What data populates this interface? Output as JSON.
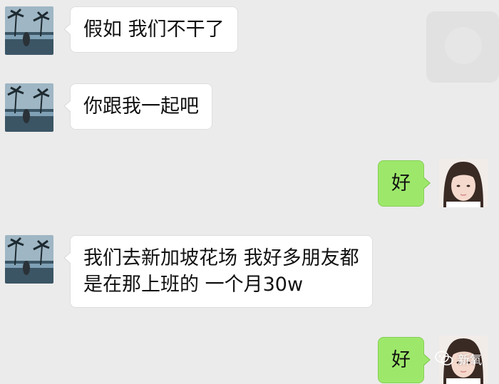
{
  "messages": [
    {
      "side": "left",
      "lines": [
        "假如 我们不干了"
      ]
    },
    {
      "side": "left",
      "lines": [
        "你跟我一起吧"
      ]
    },
    {
      "side": "right",
      "lines": [
        "好"
      ]
    },
    {
      "side": "left",
      "lines": [
        "我们去新加坡花场 我好多朋友都",
        "是在那上班的 一个月30w"
      ]
    },
    {
      "side": "right",
      "lines": [
        "好"
      ]
    }
  ],
  "watermark": {
    "text": "新氧",
    "icon": "wechat-icon"
  },
  "colors": {
    "background": "#ebebeb",
    "outgoing_bubble": "#9de86a",
    "incoming_bubble": "#ffffff"
  }
}
